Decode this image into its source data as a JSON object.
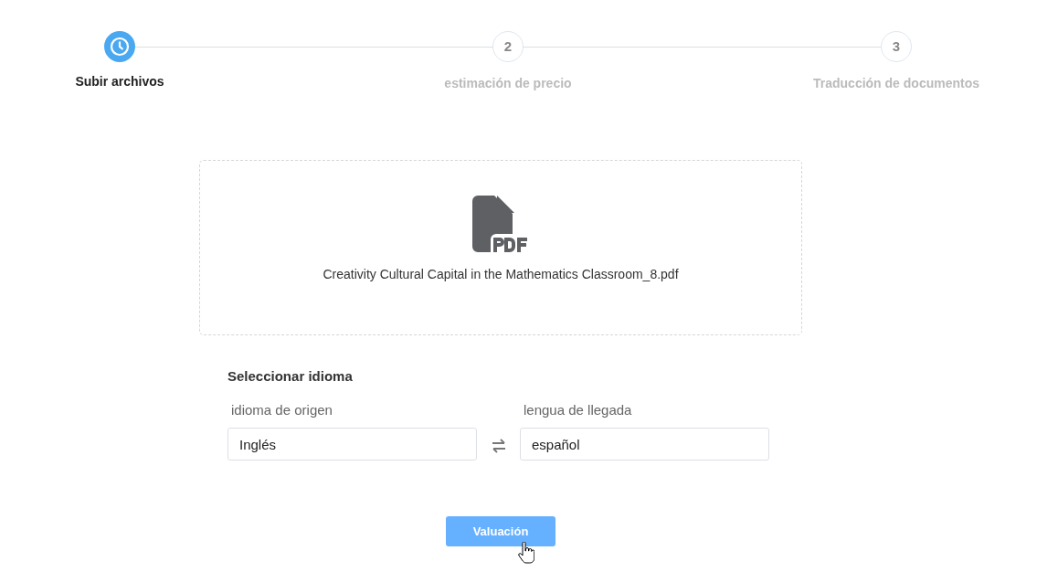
{
  "steps": [
    {
      "label": "Subir archivos",
      "active": true
    },
    {
      "number": "2",
      "label": "estimación de precio",
      "active": false
    },
    {
      "number": "3",
      "label": "Traducción de documentos",
      "active": false
    }
  ],
  "upload": {
    "file_name": "Creativity Cultural Capital in the Mathematics Classroom_8.pdf"
  },
  "language": {
    "heading": "Seleccionar idioma",
    "source_label": "idioma de origen",
    "source_value": "Inglés",
    "target_label": "lengua de llegada",
    "target_value": "español"
  },
  "button": {
    "label": "Valuación"
  }
}
